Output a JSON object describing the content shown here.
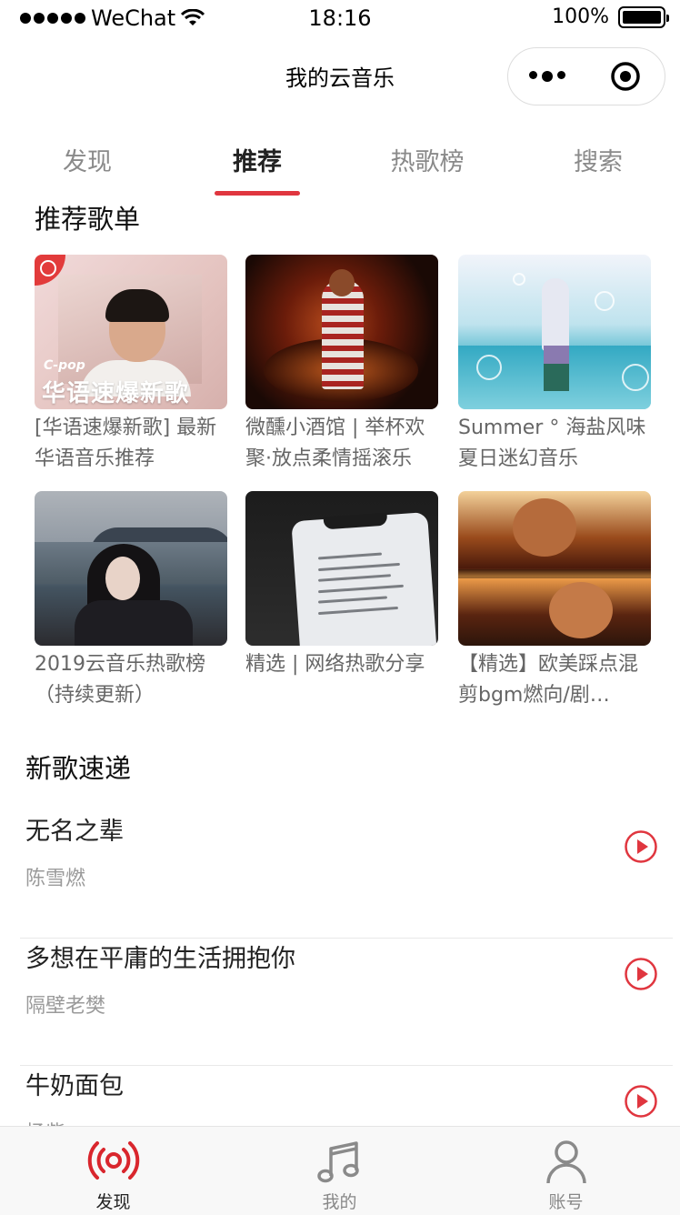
{
  "status_bar": {
    "carrier": "WeChat",
    "time": "18:16",
    "battery": "100%"
  },
  "nav": {
    "title": "我的云音乐"
  },
  "tabs": [
    {
      "label": "发现",
      "active": false
    },
    {
      "label": "推荐",
      "active": true
    },
    {
      "label": "热歌榜",
      "active": false
    },
    {
      "label": "搜索",
      "active": false
    }
  ],
  "recommend": {
    "title": "推荐歌单",
    "playlists": [
      {
        "title": "[华语速爆新歌] 最新华语音乐推荐",
        "cover_text_small": "C-pop",
        "cover_text_main": "华语速爆新歌"
      },
      {
        "title": "微醺小酒馆 | 举杯欢聚·放点柔情摇滚乐"
      },
      {
        "title": "Summer ° 海盐风味夏日迷幻音乐"
      },
      {
        "title": "2019云音乐热歌榜（持续更新）"
      },
      {
        "title": "精选 | 网络热歌分享"
      },
      {
        "title": "【精选】欧美踩点混剪bgm燃向/剧…"
      }
    ]
  },
  "new_songs": {
    "title": "新歌速递",
    "songs": [
      {
        "title": "无名之辈",
        "artist": "陈雪燃"
      },
      {
        "title": "多想在平庸的生活拥抱你",
        "artist": "隔壁老樊"
      },
      {
        "title": "牛奶面包",
        "artist": "杨紫"
      }
    ]
  },
  "tabbar": [
    {
      "label": "发现",
      "icon": "radio-icon",
      "active": true
    },
    {
      "label": "我的",
      "icon": "music-note-icon",
      "active": false
    },
    {
      "label": "账号",
      "icon": "person-icon",
      "active": false
    }
  ],
  "colors": {
    "accent": "#e0363f",
    "text_primary": "#222222",
    "text_secondary": "#9a9a9a"
  }
}
